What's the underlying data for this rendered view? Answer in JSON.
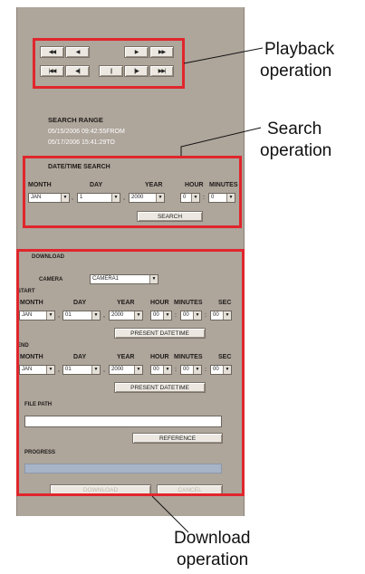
{
  "playback": {
    "row1": [
      "◀◀",
      "◀",
      "▶",
      "▶▶"
    ],
    "row2": [
      "|◀◀",
      "◀||",
      "||",
      "||▶",
      "▶▶|"
    ]
  },
  "search_range": {
    "title": "SEARCH RANGE",
    "from": "05/15/2006 09:42:55FROM",
    "to": "05/17/2006 15:41:29TO"
  },
  "date_search": {
    "title": "DATE/TIME SEARCH",
    "headers": {
      "month": "MONTH",
      "day": "DAY",
      "year": "YEAR",
      "hour": "HOUR",
      "minutes": "MINUTES"
    },
    "values": {
      "month": "JAN",
      "day": "1",
      "year": "2000",
      "hour": "0",
      "minutes": "0"
    },
    "separator_comma": ",",
    "separator_colon": ":",
    "search_button": "SEARCH"
  },
  "download": {
    "title": "DOWNLOAD",
    "camera_label": "CAMERA",
    "camera_value": "CAMERA1",
    "start_label": "START",
    "end_label": "END",
    "headers": {
      "month": "MONTH",
      "day": "DAY",
      "year": "YEAR",
      "hour": "HOUR",
      "minutes": "MINUTES",
      "sec": "SEC"
    },
    "start_values": {
      "month": "JAN",
      "day": "01",
      "year": "2000",
      "hour": "00",
      "minutes": "00",
      "sec": "00"
    },
    "end_values": {
      "month": "JAN",
      "day": "01",
      "year": "2000",
      "hour": "00",
      "minutes": "00",
      "sec": "00"
    },
    "present_datetime_button": "PRESENT DATETIME",
    "file_path_label": "FILE PATH",
    "file_path_value": "",
    "reference_button": "REFERENCE",
    "progress_label": "PROGRESS",
    "download_button": "DOWNLOAD",
    "cancel_button": "CANCEL"
  },
  "callouts": {
    "playback_line1": "Playback",
    "playback_line2": "operation",
    "search_line1": "Search",
    "search_line2": "operation",
    "download_line1": "Download",
    "download_line2": "operation"
  },
  "colors": {
    "panel": "#aea59b",
    "highlight_box": "#e0262c",
    "progress_bar": "#a7b4c8"
  }
}
